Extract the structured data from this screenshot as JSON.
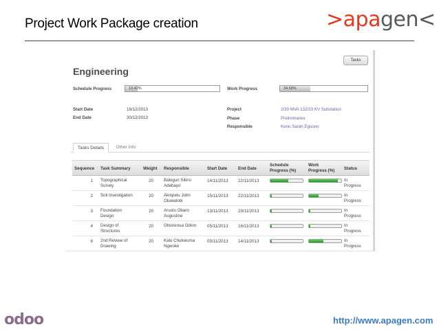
{
  "slide": {
    "title": "Project Work Package creation",
    "brand_part1": ">apa",
    "brand_part2": "gen<",
    "footer_logo": "odoo",
    "footer_url": "http://www.apagen.com"
  },
  "header": {
    "tasks_button": "Tasks",
    "title": "Engineering"
  },
  "progress": {
    "schedule_label": "Schedule Progress",
    "schedule_value": "13.42%",
    "schedule_fraction": 0.1342,
    "work_label": "Work Progress",
    "work_value": "34.68%",
    "work_fraction": 0.3468
  },
  "info": {
    "start_date_label": "Start Date",
    "start_date": "16/12/2013",
    "end_date_label": "End Date",
    "end_date": "30/12/2013",
    "project_label": "Project",
    "project": "2/30 MVA 132/33 KV Substation",
    "phase_label": "Phase",
    "phase": "Preliminaries",
    "responsible_label": "Responsible",
    "responsible": "Kenu Sarah Eguono"
  },
  "tabs": [
    "Tasks Details",
    "Other Info"
  ],
  "table": {
    "columns": {
      "sequence": "Sequence",
      "task": "Task Summary",
      "weight": "Weight",
      "responsible": "Responsible",
      "start": "Start Date",
      "end": "End Date",
      "schedule_l1": "Schedule",
      "schedule_l2": "Progress (%)",
      "work_l1": "Work",
      "work_l2": "Progress (%)",
      "status": "Status"
    },
    "rows": [
      {
        "seq": "1",
        "task1": "Topographical",
        "task2": "Survey",
        "weight": "20",
        "resp1": "Balogun Sikiru",
        "resp2": "Adebayo",
        "start": "14/11/2013",
        "end": "22/11/2013",
        "sched": 0.55,
        "work": 0.9,
        "status1": "In",
        "status2": "Progress"
      },
      {
        "seq": "2",
        "task1": "Soil Investigation",
        "task2": "",
        "weight": "20",
        "resp1": "Akinpelu John",
        "resp2": "Oluwatobi",
        "start": "15/11/2013",
        "end": "22/11/2013",
        "sched": 0.05,
        "work": 0.3,
        "status1": "In",
        "status2": "Progress"
      },
      {
        "seq": "3",
        "task1": "Foundation",
        "task2": "Design",
        "weight": "20",
        "resp1": "Aruolu Obaro",
        "resp2": "Augustine",
        "start": "13/11/2013",
        "end": "29/11/2013",
        "sched": 0.05,
        "work": 0.04,
        "status1": "In",
        "status2": "Progress"
      },
      {
        "seq": "4",
        "task1": "Design of",
        "task2": "Structures",
        "weight": "20",
        "resp1": "Ohiorenua Odion",
        "resp2": "",
        "start": "05/11/2013",
        "end": "16/11/2013",
        "sched": 0.04,
        "work": 0.04,
        "status1": "In",
        "status2": "Progress"
      },
      {
        "seq": "6",
        "task1": "2nd Review of",
        "task2": "Drawing",
        "weight": "20",
        "resp1": "Kalu Chukwuma",
        "resp2": "Ngwoke",
        "start": "05/11/2013",
        "end": "14/11/2013",
        "sched": 0.04,
        "work": 0.45,
        "status1": "In",
        "status2": "Progress"
      }
    ]
  }
}
